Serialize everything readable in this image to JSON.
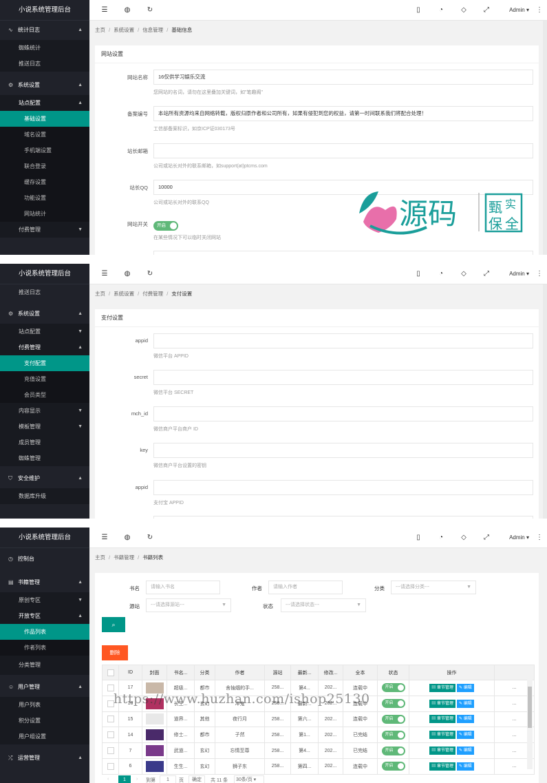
{
  "colors": {
    "sidebar": "#20222a",
    "accent": "#009688",
    "danger": "#ff5722",
    "toggle": "#5fb878",
    "edit": "#1e9fff"
  },
  "icons": {
    "menu": "menu-fold-icon",
    "globe": "globe-icon",
    "refresh": "refresh-icon",
    "note": "note-icon",
    "theme": "theme-icon",
    "tag": "tag-icon",
    "fullscreen": "fullscreen-icon",
    "more": "more-icon"
  },
  "app_title": "小说系统管理后台",
  "admin_label": "Admin",
  "panel1": {
    "nav": {
      "g1": "统计日志",
      "g1_s1": "蜘蛛统计",
      "g1_s2": "推送日志",
      "g2": "系统设置",
      "g2_s1": "站点配置",
      "g2_ss": [
        "基础设置",
        "域名设置",
        "手机端设置",
        "联合登录",
        "缓存设置",
        "功能设置",
        "网站统计"
      ],
      "g2_s2": "付费管理"
    },
    "crumb": [
      "主页",
      "系统设置",
      "信息管理",
      "基础信息"
    ],
    "card_title": "网站设置",
    "fields": [
      {
        "label": "网站名称",
        "value": "16仅供学习娱乐交流",
        "help": "您网站的名词，请勿在这里叠加关键词，如\"笔趣阁\""
      },
      {
        "label": "备案编号",
        "value": "本站所有资源均来自网络转载，版权归原作者和公司所有，如果有侵犯到您的权益，请第一时间联系我们将配合处理！",
        "help": "工信部备案标识，如京ICP证030173号"
      },
      {
        "label": "站长邮箱",
        "value": "",
        "help": "公司或站长对外的联系邮箱，如support(at)ptcms.com"
      },
      {
        "label": "站长QQ",
        "value": "10000",
        "help": "公司或站长对外的联系QQ"
      }
    ],
    "switch": {
      "label": "网站开关",
      "state": "开启",
      "help": "在某些情况下可以临时关闭网站"
    },
    "logo": {
      "text1": "源码",
      "seal": [
        "甄",
        "实",
        "保",
        "全"
      ]
    }
  },
  "panel2": {
    "nav": {
      "s0": "推送日志",
      "g1": "系统设置",
      "s1": "站点配置",
      "s2": "付费管理",
      "ss": [
        "支付配置",
        "充值设置",
        "会员类型"
      ],
      "s3": "内容显示",
      "s4": "模板管理",
      "s5": "成员管理",
      "s6": "蜘蛛管理",
      "g2": "安全维护",
      "s7": "数据库升级"
    },
    "crumb": [
      "主页",
      "系统设置",
      "付费管理",
      "支付设置"
    ],
    "card_title": "支付设置",
    "fields": [
      {
        "label": "appid",
        "help": "微信平台 APPID"
      },
      {
        "label": "secret",
        "help": "微信平台 SECRET"
      },
      {
        "label": "mch_id",
        "help": "微信商户平台商户 ID"
      },
      {
        "label": "key",
        "help": "微信商户平台设置的密钥"
      },
      {
        "label": "appid",
        "help": "支付宝 APPID"
      }
    ]
  },
  "panel3": {
    "nav": {
      "g0": "控制台",
      "g1": "书籍管理",
      "s1": "原创专区",
      "s2": "开放专区",
      "ss": [
        "作品列表",
        "作者列表"
      ],
      "s3": "分类管理",
      "g2": "用户管理",
      "s4": "用户列表",
      "s5": "积分设置",
      "s6": "用户组设置",
      "g3": "运营管理"
    },
    "crumb": [
      "书籍管理",
      "书籍列表"
    ],
    "crumb_home": "主页",
    "search": {
      "book_label": "书名",
      "book_ph": "请输入书名",
      "author_label": "作者",
      "author_ph": "请输入作者",
      "cat_label": "分类",
      "cat_ph": "---请选择分类---",
      "src_label": "源站",
      "src_ph": "---请选择源站---",
      "status_label": "状态",
      "status_ph": "---请选择状态---"
    },
    "delete_label": "删除",
    "columns": [
      "ID",
      "封面",
      "书名...",
      "分类",
      "作者",
      "源站",
      "最新...",
      "修改...",
      "全本",
      "状态",
      "操作"
    ],
    "rows": [
      {
        "id": "17",
        "name": "超级...",
        "cat": "都市",
        "author": "舍抽烟的手...",
        "src": "258...",
        "latest": "第4...",
        "mod": "202...",
        "full": "连载中"
      },
      {
        "id": "16",
        "name": "长生...",
        "cat": "玄幻",
        "author": "冲鬼",
        "src": "258...",
        "latest": "最新...",
        "mod": "202...",
        "full": "连载中"
      },
      {
        "id": "15",
        "name": "道界...",
        "cat": "其他",
        "author": "夜行月",
        "src": "258...",
        "latest": "第六...",
        "mod": "202...",
        "full": "连载中"
      },
      {
        "id": "14",
        "name": "修士...",
        "cat": "都市",
        "author": "子然",
        "src": "258...",
        "latest": "第1...",
        "mod": "202...",
        "full": "已完结"
      },
      {
        "id": "7",
        "name": "武道...",
        "cat": "玄幻",
        "author": "忘情至尊",
        "src": "258...",
        "latest": "第4...",
        "mod": "202...",
        "full": "已完结"
      },
      {
        "id": "6",
        "name": "生生...",
        "cat": "玄幻",
        "author": "狮子东",
        "src": "258...",
        "latest": "第四...",
        "mod": "202...",
        "full": "连载中"
      }
    ],
    "status_on": "开启",
    "op_chapter": "章节管理",
    "op_edit": "编辑",
    "pager": {
      "current": "1",
      "goto": "到第",
      "page_input": "1",
      "page_unit": "页",
      "confirm": "确定",
      "total": "共 11 条",
      "size": "30条/页"
    }
  },
  "watermark": "https://www.huzhan.com/ishop25130"
}
